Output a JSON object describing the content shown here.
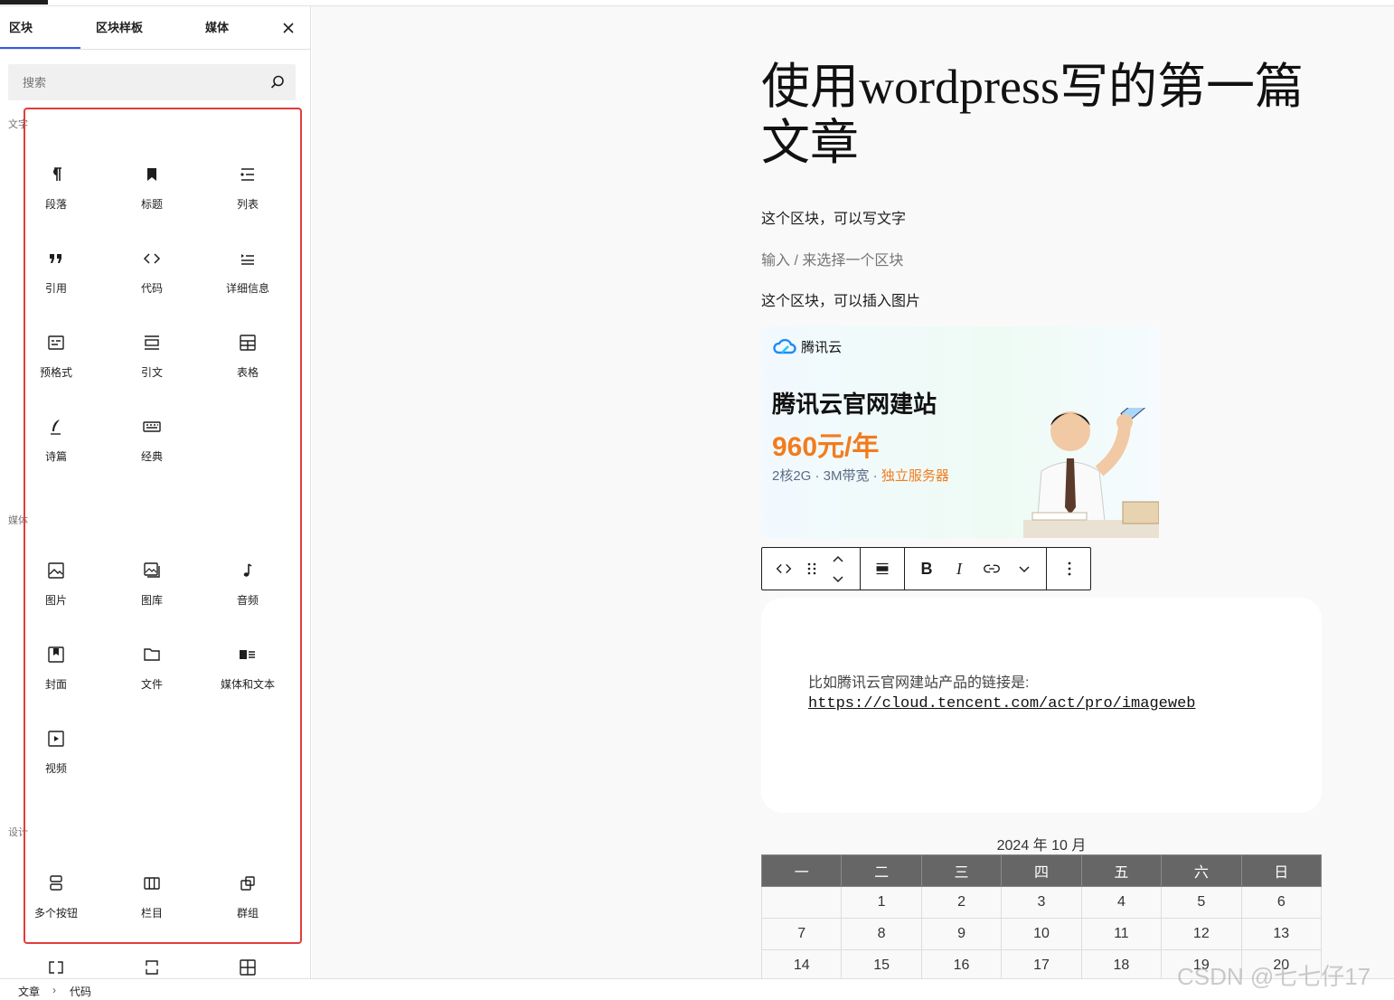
{
  "sidebar": {
    "tabs": [
      {
        "label": "区块"
      },
      {
        "label": "区块样板"
      },
      {
        "label": "媒体"
      }
    ],
    "close_icon": "close-icon",
    "search": {
      "placeholder": "搜索",
      "icon": "search-icon"
    },
    "categories": {
      "text": "文字",
      "media": "媒体",
      "design": "设计"
    },
    "text_blocks": [
      {
        "label": "段落",
        "icon": "paragraph-icon"
      },
      {
        "label": "标题",
        "icon": "heading-icon"
      },
      {
        "label": "列表",
        "icon": "list-icon"
      },
      {
        "label": "引用",
        "icon": "quote-icon"
      },
      {
        "label": "代码",
        "icon": "code-icon"
      },
      {
        "label": "详细信息",
        "icon": "details-icon"
      },
      {
        "label": "预格式",
        "icon": "preformatted-icon"
      },
      {
        "label": "引文",
        "icon": "pullquote-icon"
      },
      {
        "label": "表格",
        "icon": "table-icon"
      },
      {
        "label": "诗篇",
        "icon": "verse-icon"
      },
      {
        "label": "经典",
        "icon": "classic-icon"
      }
    ],
    "media_blocks": [
      {
        "label": "图片",
        "icon": "image-icon"
      },
      {
        "label": "图库",
        "icon": "gallery-icon"
      },
      {
        "label": "音频",
        "icon": "audio-icon"
      },
      {
        "label": "封面",
        "icon": "cover-icon"
      },
      {
        "label": "文件",
        "icon": "file-icon"
      },
      {
        "label": "媒体和文本",
        "icon": "media-text-icon"
      },
      {
        "label": "视频",
        "icon": "video-icon"
      }
    ],
    "design_blocks": [
      {
        "label": "多个按钮",
        "icon": "buttons-icon"
      },
      {
        "label": "栏目",
        "icon": "columns-icon"
      },
      {
        "label": "群组",
        "icon": "group-icon"
      }
    ],
    "partial_blocks": [
      {
        "icon": "row-icon"
      },
      {
        "icon": "stack-icon"
      },
      {
        "icon": "grid-icon"
      }
    ]
  },
  "editor": {
    "title": "使用wordpress写的第一篇文章",
    "para1": "这个区块，可以写文字",
    "placeholder": "输入 / 来选择一个区块",
    "para2": "这个区块，可以插入图片",
    "banner": {
      "logo": "腾讯云",
      "heading": "腾讯云官网建站",
      "price": "960元/年",
      "spec_main": "2核2G · 3M带宽 · ",
      "spec_accent": "独立服务器"
    },
    "toolbar": {
      "icons": [
        "code-icon",
        "drag-handle-icon",
        "move-up-icon",
        "move-down-icon",
        "align-icon",
        "bold-icon",
        "italic-icon",
        "link-icon",
        "chevron-down-icon",
        "more-options-icon"
      ],
      "bold": "B",
      "italic": "I"
    },
    "code_block": {
      "text": "比如腾讯云官网建站产品的链接是:",
      "link": "https://cloud.tencent.com/act/pro/imageweb"
    },
    "calendar": {
      "caption": "2024 年 10 月",
      "headers": [
        "一",
        "二",
        "三",
        "四",
        "五",
        "六",
        "日"
      ],
      "rows": [
        [
          "",
          "1",
          "2",
          "3",
          "4",
          "5",
          "6"
        ],
        [
          "7",
          "8",
          "9",
          "10",
          "11",
          "12",
          "13"
        ],
        [
          "14",
          "15",
          "16",
          "17",
          "18",
          "19",
          "20"
        ]
      ]
    }
  },
  "statusbar": {
    "breadcrumb": [
      "文章",
      "代码"
    ],
    "separator": "›"
  },
  "watermark": "CSDN @七七仔17",
  "colors": {
    "accent": "#3858e9",
    "highlight_box": "#e23c3c",
    "price": "#f27c1d",
    "calendar_header": "#666666"
  }
}
